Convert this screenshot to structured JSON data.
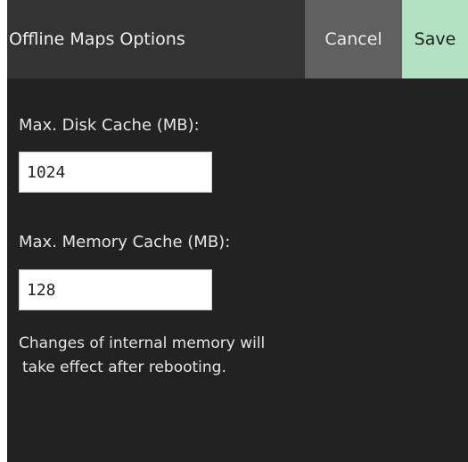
{
  "dialog": {
    "title": "Offline Maps Options",
    "cancel_label": "Cancel",
    "save_label": "Save"
  },
  "fields": {
    "disk_cache": {
      "label": "Max. Disk Cache (MB):",
      "value": "1024"
    },
    "memory_cache": {
      "label": "Max. Memory Cache (MB):",
      "value": "128"
    }
  },
  "note": {
    "line1": "Changes of internal memory will",
    "line2": "take effect after rebooting."
  },
  "colors": {
    "background": "#222222",
    "titlebar": "#333333",
    "cancel_button": "#606060",
    "save_button": "#b3e2c3"
  }
}
